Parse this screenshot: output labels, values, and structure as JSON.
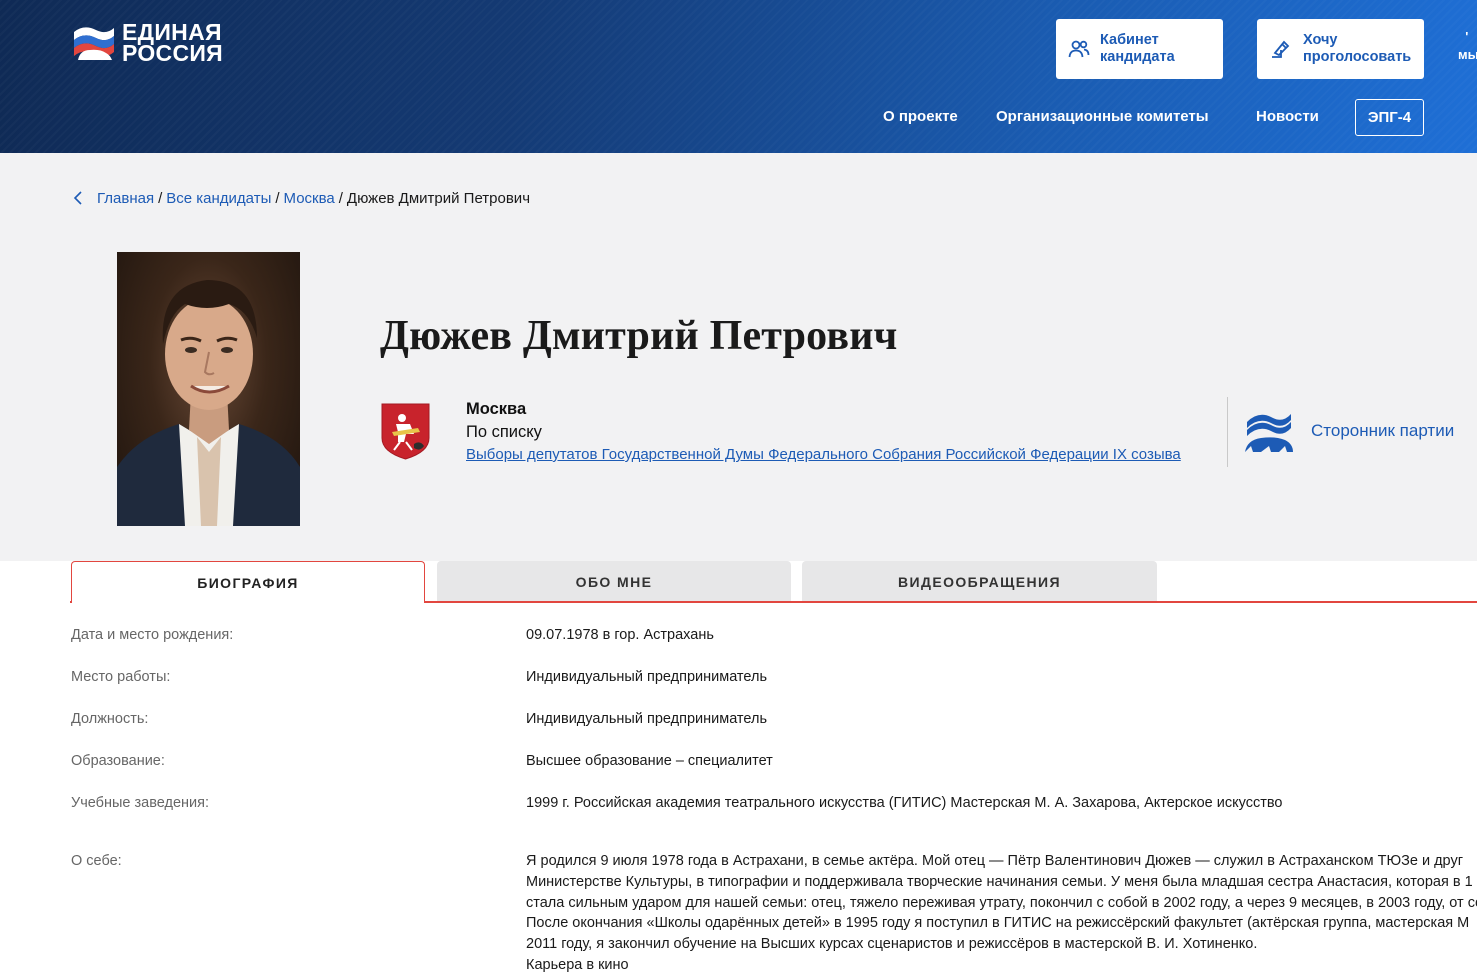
{
  "header": {
    "logo": {
      "line1": "ЕДИНАЯ",
      "line2": "РОССИЯ"
    },
    "buttons": {
      "cabinet": "Кабинет кандидата",
      "vote": "Хочу проголосовать"
    },
    "edge_text": "мы",
    "nav": [
      {
        "label": "О проекте"
      },
      {
        "label": "Организационные комитеты"
      },
      {
        "label": "Новости"
      }
    ],
    "epg_label": "ЭПГ-4",
    "colors": {
      "accent_blue": "#1d5bb5",
      "tab_red": "#e2463f"
    }
  },
  "breadcrumb": {
    "items": [
      "Главная",
      "Все кандидаты",
      "Москва"
    ],
    "current": "Дюжев Дмитрий Петрович"
  },
  "candidate": {
    "name": "Дюжев Дмитрий Петрович",
    "region": "Москва",
    "mode": "По списку",
    "election": "Выборы депутатов Государственной Думы Федерального Собрания Российской Федерации IX созыва",
    "status": "Сторонник партии"
  },
  "tabs": [
    {
      "label": "БИОГРАФИЯ",
      "active": true
    },
    {
      "label": "ОБО МНЕ",
      "active": false
    },
    {
      "label": "ВИДЕООБРАЩЕНИЯ",
      "active": false
    }
  ],
  "bio": {
    "birth": {
      "label": "Дата и место рождения:",
      "value": "09.07.1978 в гор. Астрахань"
    },
    "work": {
      "label": "Место работы:",
      "value": "Индивидуальный предприниматель"
    },
    "position": {
      "label": "Должность:",
      "value": "Индивидуальный предприниматель"
    },
    "education": {
      "label": "Образование:",
      "value": "Высшее образование – специалитет"
    },
    "institutions": {
      "label": "Учебные заведения:",
      "value": "1999 г. Российская академия театрального искусства (ГИТИС) Мастерская М. А. Захарова, Актерское искусство"
    },
    "about": {
      "label": "О себе:",
      "lines": [
        "Я родился 9 июля 1978 года в Астрахани, в семье актёра. Мой отец — Пётр Валентинович Дюжев — служил в Астраханском ТЮЗе и друг",
        "Министерстве Культуры, в типографии и поддерживала творческие начинания семьи. У меня была младшая сестра Анастасия, которая в 1",
        "стала сильным ударом для нашей семьи: отец, тяжело переживая утрату, покончил с собой в 2002 году, а через 9 месяцев, в 2003 году, от се",
        "После окончания «Школы одарённых детей» в 1995 году я поступил в ГИТИС на режиссёрский факультет (актёрская группа, мастерская М",
        "2011 году, я закончил обучение на Высших курсах сценаристов и режиссёров в мастерской В. И. Хотиненко.",
        "Карьера в кино"
      ]
    }
  }
}
